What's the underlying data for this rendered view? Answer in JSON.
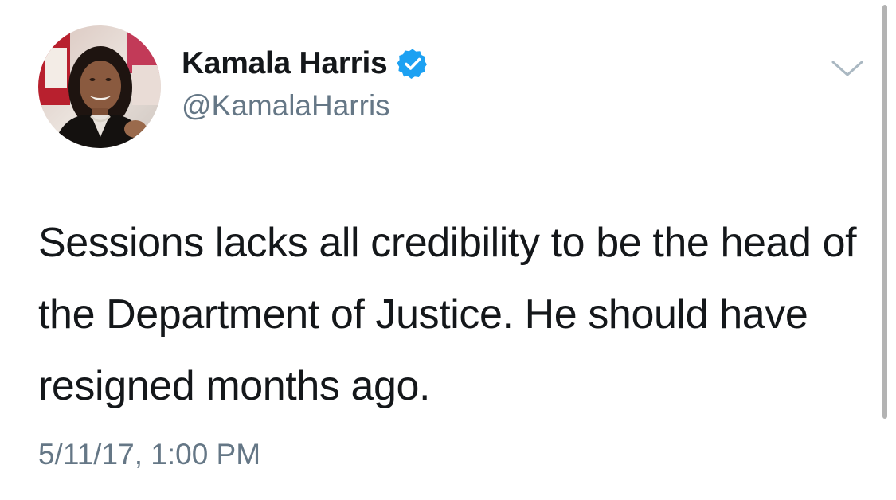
{
  "tweet": {
    "author": {
      "display_name": "Kamala Harris",
      "handle": "@KamalaHarris",
      "verified": true,
      "avatar": "profile-photo"
    },
    "text": "Sessions lacks all credibility to be the head of the Department of Justice. He should have resigned months ago.",
    "timestamp": "5/11/17, 1:00 PM",
    "menu_icon": "chevron-down-icon"
  },
  "colors": {
    "text_primary": "#14171a",
    "text_secondary": "#657786",
    "verified_blue": "#1da1f2",
    "caret_gray": "#aab8c2",
    "scrollbar": "#b3b3b3",
    "background": "#ffffff"
  }
}
